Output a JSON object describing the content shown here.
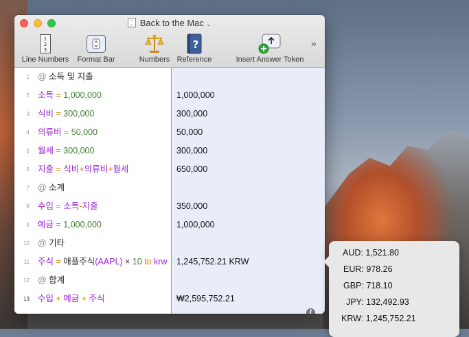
{
  "window": {
    "title": "Back to the Mac"
  },
  "toolbar": {
    "line_numbers": "Line Numbers",
    "format_bar": "Format Bar",
    "numbers": "Numbers",
    "reference": "Reference",
    "insert_answer_token": "Insert Answer Token",
    "more": "»"
  },
  "lines": [
    {
      "n": "1",
      "parts": [
        [
          "@ ",
          "at"
        ],
        [
          "소득 및 지출",
          "head"
        ]
      ],
      "result": ""
    },
    {
      "n": "2",
      "parts": [
        [
          "소득",
          "var"
        ],
        [
          " = ",
          "op"
        ],
        [
          "1,000,000",
          "num"
        ]
      ],
      "result": "1,000,000"
    },
    {
      "n": "3",
      "parts": [
        [
          "식비",
          "var"
        ],
        [
          " = ",
          "op"
        ],
        [
          "300,000",
          "num"
        ]
      ],
      "result": "300,000"
    },
    {
      "n": "4",
      "parts": [
        [
          "의류비",
          "var"
        ],
        [
          " = ",
          "op"
        ],
        [
          "50,000",
          "num"
        ]
      ],
      "result": "50,000"
    },
    {
      "n": "5",
      "parts": [
        [
          "월세",
          "var"
        ],
        [
          " = ",
          "op"
        ],
        [
          "300,000",
          "num"
        ]
      ],
      "result": "300,000"
    },
    {
      "n": "6",
      "parts": [
        [
          "지출",
          "var"
        ],
        [
          " = ",
          "op"
        ],
        [
          "식비",
          "var"
        ],
        [
          "+",
          "op"
        ],
        [
          "의류비",
          "var"
        ],
        [
          "+",
          "op"
        ],
        [
          "월세",
          "var"
        ]
      ],
      "result": "650,000"
    },
    {
      "n": "7",
      "parts": [
        [
          "@ ",
          "at"
        ],
        [
          "소계",
          "head"
        ]
      ],
      "result": ""
    },
    {
      "n": "8",
      "parts": [
        [
          "수입",
          "var"
        ],
        [
          " = ",
          "op"
        ],
        [
          "소득",
          "var"
        ],
        [
          "-",
          "op"
        ],
        [
          "지출",
          "var"
        ]
      ],
      "result": "350,000"
    },
    {
      "n": "9",
      "parts": [
        [
          "예금",
          "var"
        ],
        [
          " = ",
          "op"
        ],
        [
          "1,000,000",
          "num"
        ]
      ],
      "result": "1,000,000"
    },
    {
      "n": "10",
      "parts": [
        [
          "@ ",
          "at"
        ],
        [
          "기타",
          "head"
        ]
      ],
      "result": ""
    },
    {
      "n": "11",
      "parts": [
        [
          "주식",
          "var"
        ],
        [
          " = ",
          "op"
        ],
        [
          "애플주식",
          "fn"
        ],
        [
          "(AAPL)",
          "var"
        ],
        [
          " × ",
          "fn"
        ],
        [
          "10",
          "num"
        ],
        [
          " to ",
          "op"
        ],
        [
          "krw",
          "unit"
        ]
      ],
      "result": "1,245,752.21 KRW"
    },
    {
      "n": "12",
      "parts": [
        [
          "@ ",
          "at"
        ],
        [
          "합계",
          "head"
        ]
      ],
      "result": ""
    },
    {
      "n": "13",
      "parts": [
        [
          "수입",
          "var"
        ],
        [
          " + ",
          "op"
        ],
        [
          "예금",
          "var"
        ],
        [
          " + ",
          "op"
        ],
        [
          "주식",
          "var"
        ]
      ],
      "result": "₩2,595,752.21"
    }
  ],
  "current_line": "13",
  "info_icon": "info-icon",
  "popover": [
    "AUD: 1,521.80",
    "EUR: 978.26",
    "GBP: 718.10",
    "JPY: 132,492.93",
    "KRW: 1,245,752.21"
  ],
  "colors": {
    "variable": "#9a1fd8",
    "operator": "#d67a00",
    "number": "#3d7f2e",
    "results_bg": "#e9edf9"
  }
}
